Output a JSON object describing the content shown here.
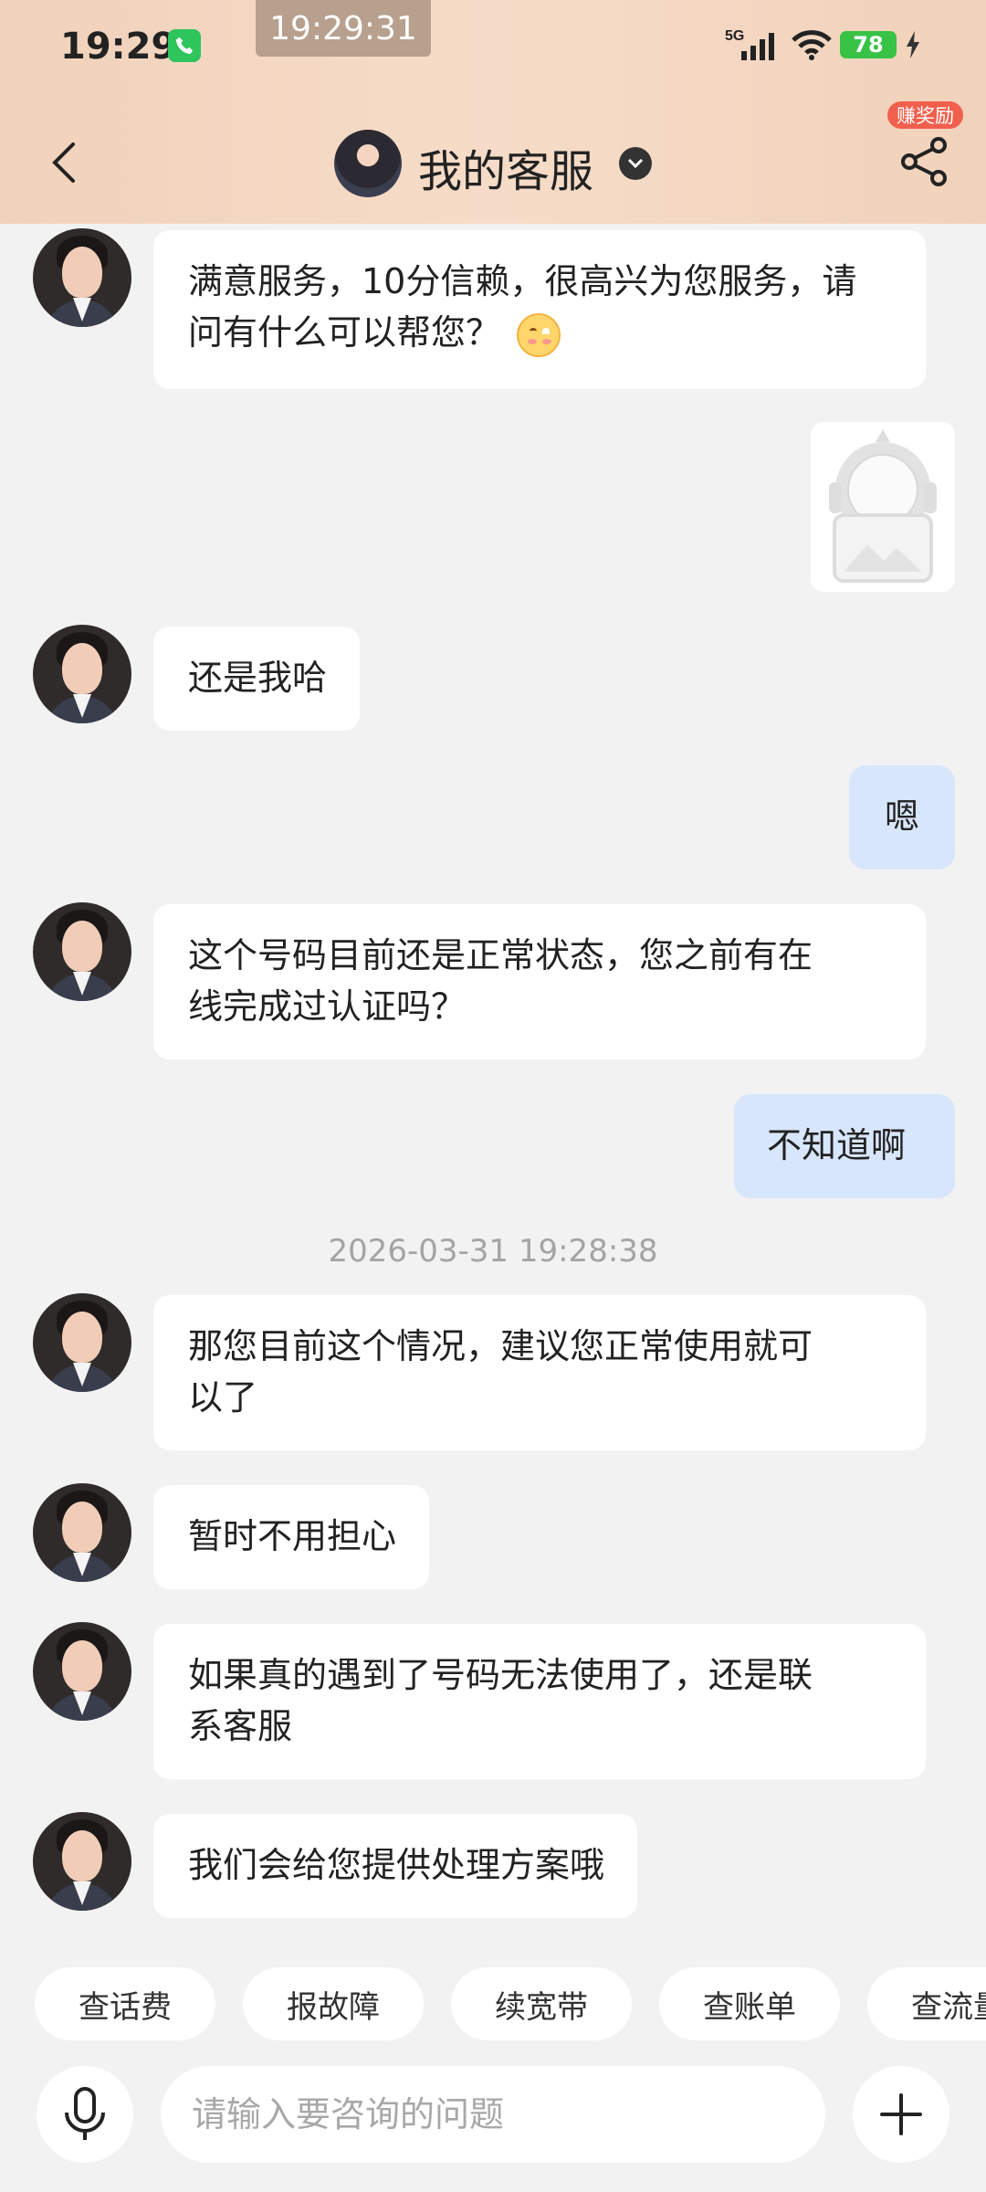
{
  "status_bar": {
    "time": "19:29",
    "overlay_clock": "19:29:31",
    "network": "5G",
    "battery": "78"
  },
  "header": {
    "title": "我的客服",
    "badge": "赚奖励"
  },
  "messages": {
    "m1": [
      "满意服务，10分信赖，很高兴为您服务，请",
      "问有什么可以帮您？"
    ],
    "m2": "还是我哈",
    "m3": "嗯",
    "m4": [
      "这个号码目前还是正常状态，您之前有在",
      "线完成过认证吗？"
    ],
    "m5": "不知道啊",
    "timestamp": "2026-03-31 19:28:38",
    "m6": [
      "那您目前这个情况，建议您正常使用就可",
      "以了"
    ],
    "m7": "暂时不用担心",
    "m8": [
      "如果真的遇到了号码无法使用了，还是联",
      "系客服"
    ],
    "m9": "我们会给您提供处理方案哦"
  },
  "quick_actions": [
    "查话费",
    "报故障",
    "续宽带",
    "查账单",
    "查流量"
  ],
  "input": {
    "placeholder": "请输入要咨询的问题",
    "value": ""
  },
  "colors": {
    "header_bg": "#f4d8c3",
    "bubble_out": "#d8e6fb",
    "bubble_in": "#ffffff",
    "badge": "#f0604d",
    "battery": "#38c246"
  }
}
